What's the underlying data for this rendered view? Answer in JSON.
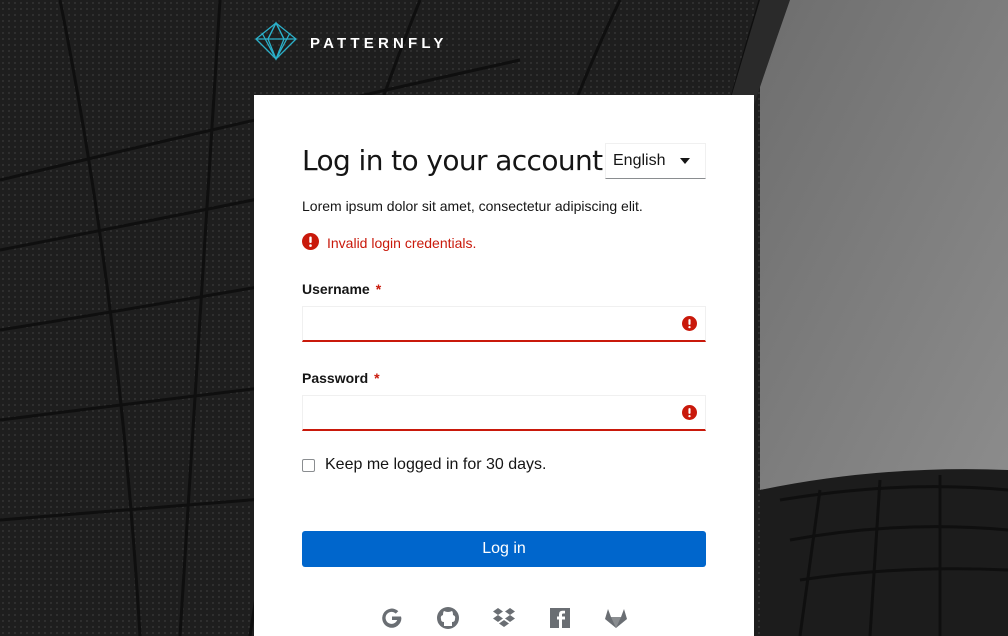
{
  "brand": {
    "name": "PATTERNFLY"
  },
  "login": {
    "title": "Log in to your account",
    "description": "Lorem ipsum dolor sit amet, consectetur adipiscing elit.",
    "error_message": "Invalid login credentials.",
    "language": {
      "selected": "English"
    },
    "username": {
      "label": "Username",
      "required_mark": "*",
      "value": ""
    },
    "password": {
      "label": "Password",
      "required_mark": "*",
      "value": ""
    },
    "remember": {
      "label": "Keep me logged in for 30 days.",
      "checked": false
    },
    "submit_label": "Log in"
  },
  "social_icons": [
    "google-icon",
    "github-icon",
    "dropbox-icon",
    "facebook-icon",
    "gitlab-icon"
  ],
  "colors": {
    "primary": "#0066cc",
    "danger": "#c9190b",
    "text": "#151515",
    "brand_teal": "#2bb0c9"
  }
}
